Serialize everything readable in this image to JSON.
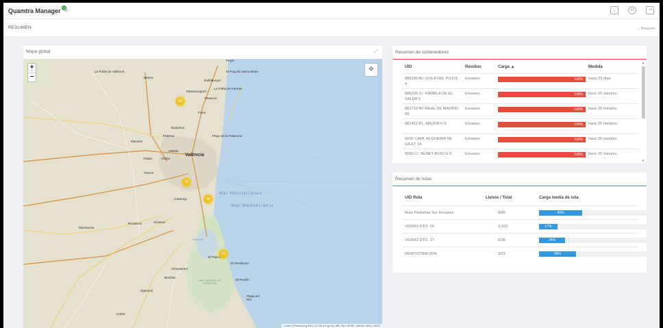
{
  "app": {
    "brand": "Quamtra Manager"
  },
  "subheader": {
    "title": "RESUMEN",
    "breadcrumb": "Resumen"
  },
  "map": {
    "title": "Mapa global",
    "zoom_in": "+",
    "zoom_out": "−",
    "clusters": [
      {
        "label": "60"
      },
      {
        "label": "76"
      },
      {
        "label": "44"
      },
      {
        "label": "72"
      }
    ],
    "labels": {
      "pucol": "Puçol",
      "pobla_vallbona": "La Pobla de Vallbona",
      "betera": "Bétera",
      "puig": "El Puig de Santa Maria",
      "rafelbunyol": "Rafelbunyol",
      "massamagrell": "Massamagrell",
      "pobla_farnals": "La Pobla de Farnals",
      "museros": "Museros",
      "foios": "Foios",
      "paterna": "Paterna",
      "burjassot": "Burjassot",
      "platja_patacona": "Playa de la Patacona",
      "manises": "Manises",
      "mislata": "Mislata",
      "valencia": "València",
      "aldaia": "Aldaia",
      "alfafar": "Alfafar",
      "torrent": "Torrent",
      "catarroja": "Catarroja",
      "mar1": "Mar Mediterràneo",
      "mar2": "Mar Mediterrània",
      "montserrat": "Montserrat",
      "picassent": "Picassent",
      "alcasser": "Alcàsser",
      "albufera": "L'Albufera",
      "el_palmar": "El Palmar",
      "perellonet": "El Perellonet",
      "almussafes": "Almussafes",
      "benifaio": "Benifaió",
      "perello": "El Perelló",
      "parc_natural": "PARC NATURAL DE L'ALBUFERA",
      "algemesi": "Algemesí",
      "platja_rei": "Platja del Rei",
      "carlet": "Carlet"
    },
    "attribution_link": "Leaflet",
    "attribution_text": "| Powered by Esri | CC by 4.0 ign.es, INE, Esri, HERE, Garmin, NGA, USGS"
  },
  "containers": {
    "title": "Resumen de contenedores",
    "columns": {
      "uid": "UID",
      "residuo": "Residuo",
      "carga": "Carga ▲",
      "medida": "Medida"
    },
    "rows": [
      {
        "uid": "886338 AV. GOLA DEL PUJOL 4",
        "residuo": "Envases",
        "carga": 100,
        "carga_label": "100%",
        "medida": "hace 23 días"
      },
      {
        "uid": "886336 C/. RAMBLA DE EL SALER 0",
        "residuo": "Envases",
        "carga": 100,
        "carga_label": "100%",
        "medida": "hace 25 minutos"
      },
      {
        "uid": "883719 AV. REAL DE MADRID 59",
        "residuo": "Envases",
        "carga": 100,
        "carga_label": "100%",
        "medida": "hace 26 minutos"
      },
      {
        "uid": "882452 PL. MAJOR F-3",
        "residuo": "Envases",
        "carga": 100,
        "carga_label": "100%",
        "medida": "hace 25 minutos"
      },
      {
        "uid": "5600 CAMI. ALQUERIA DE GILET 14",
        "residuo": "Envases",
        "carga": 100,
        "carga_label": "100%",
        "medida": "hace 25 minutos"
      },
      {
        "uid": "5590 C/. BENET BOSCH 6",
        "residuo": "Envases",
        "carga": 100,
        "carga_label": "100%",
        "medida": "hace 25 minutos"
      }
    ]
  },
  "routes": {
    "title": "Resumen de rutas",
    "columns": {
      "uid": "UID Ruta",
      "llenos": "Llenos / Total",
      "carga": "Carga media de ruta"
    },
    "rows": [
      {
        "uid": "Ruta Pedanías Sur Envases",
        "llenos": "8/85",
        "carga": 40,
        "carga_label": "40%"
      },
      {
        "uid": "VIDRIO-DTO. 19",
        "llenos": "1/102",
        "carga": 17,
        "carga_label": "17%"
      },
      {
        "uid": "VIDRIO-DTO. 17",
        "llenos": "0/36",
        "carga": 24,
        "carga_label": "24%"
      },
      {
        "uid": "DEMOSTRACION",
        "llenos": "3/21",
        "carga": 34,
        "carga_label": "34%"
      }
    ]
  },
  "colors": {
    "load_bar": "#e64c3c",
    "route_bar": "#3598dc",
    "sea": "#b9d3ea",
    "land": "#e8e2d2"
  }
}
